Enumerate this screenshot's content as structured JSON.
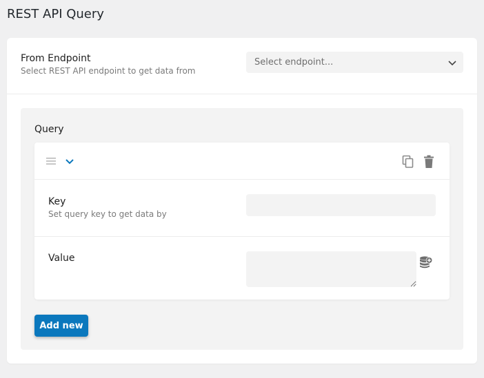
{
  "page": {
    "title": "REST API Query"
  },
  "endpoint": {
    "label": "From Endpoint",
    "help": "Select REST API endpoint to get data from",
    "placeholder": "Select endpoint..."
  },
  "query": {
    "title": "Query",
    "item": {
      "key_label": "Key",
      "key_help": "Set query key to get data by",
      "key_value": "",
      "value_label": "Value",
      "value_value": ""
    },
    "add_label": "Add new"
  },
  "colors": {
    "accent": "#0b78bd",
    "background": "#f0f0f1",
    "field": "#f3f3f3",
    "toggle": "#0b78bd"
  },
  "icons": [
    "chevron-down-icon",
    "drag-handle-icon",
    "copy-icon",
    "trash-icon",
    "database-add-icon"
  ]
}
